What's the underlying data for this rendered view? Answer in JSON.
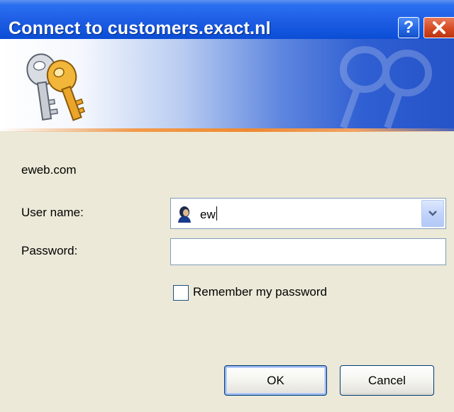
{
  "window": {
    "title": "Connect to customers.exact.nl",
    "help_label": "?",
    "close_label": "✕"
  },
  "dialog": {
    "server": "eweb.com",
    "username_label": "User name:",
    "username_value": "ew",
    "password_label": "Password:",
    "password_value": "",
    "remember_label": "Remember my password",
    "remember_checked": false,
    "ok_label": "OK",
    "cancel_label": "Cancel"
  },
  "colors": {
    "title_bar": "#0a47c8",
    "dialog_bg": "#ece9d8",
    "accent_line": "#ee8a32"
  },
  "icons": {
    "banner": "keys-icon",
    "watermark": "keys-watermark-icon",
    "user": "user-icon",
    "dropdown": "chevron-down-icon"
  }
}
